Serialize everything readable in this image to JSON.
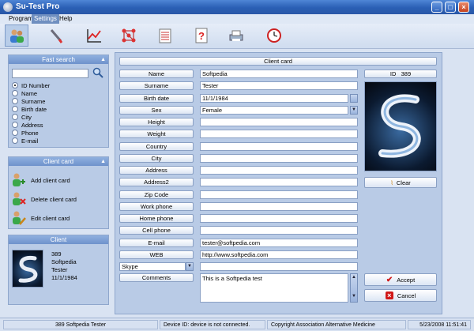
{
  "window": {
    "title": "Su-Test Pro",
    "minimize": "_",
    "maximize": "□",
    "close": "×"
  },
  "menu": [
    "Program",
    "Settings",
    "Help"
  ],
  "toolbar": {
    "icons": [
      "clients-icon",
      "pipette-icon",
      "chart-icon",
      "molecule-icon",
      "notepad-icon",
      "question-icon",
      "printer-icon",
      "clock-icon"
    ]
  },
  "fast_search": {
    "title": "Fast search",
    "query": "",
    "options": [
      "ID Number",
      "Name",
      "Surname",
      "Birth date",
      "City",
      "Address",
      "Phone",
      "E-mail"
    ],
    "selected": "ID Number"
  },
  "client_card_panel": {
    "title": "Client card",
    "actions": [
      "Add client card",
      "Delete client card",
      "Edit client card"
    ]
  },
  "client_panel": {
    "title": "Client",
    "lines": [
      "389",
      "Softpedia",
      "Tester",
      "11/1/1984"
    ]
  },
  "form": {
    "title": "Client card",
    "fields": [
      {
        "label": "Name",
        "value": "Softpedia"
      },
      {
        "label": "Surname",
        "value": "Tester"
      },
      {
        "label": "Birth date",
        "value": "11/1/1984"
      },
      {
        "label": "Sex",
        "value": "Female"
      },
      {
        "label": "Height",
        "value": ""
      },
      {
        "label": "Weight",
        "value": ""
      },
      {
        "label": "Country",
        "value": ""
      },
      {
        "label": "City",
        "value": ""
      },
      {
        "label": "Address",
        "value": ""
      },
      {
        "label": "Address2",
        "value": ""
      },
      {
        "label": "Zip Code",
        "value": ""
      },
      {
        "label": "Work phone",
        "value": ""
      },
      {
        "label": "Home phone",
        "value": ""
      },
      {
        "label": "Cell phone",
        "value": ""
      },
      {
        "label": "E-mail",
        "value": "tester@softpedia.com"
      },
      {
        "label": "WEB",
        "value": "http://www.softpedia.com"
      },
      {
        "label": "Skype",
        "value": ""
      }
    ],
    "comments_label": "Comments",
    "comments_value": "This is a Softpedia test",
    "id_label": "ID",
    "id_value": "389",
    "clear_label": "Clear",
    "accept_label": "Accept",
    "cancel_label": "Cancel"
  },
  "status": {
    "client": "389   Softpedia   Tester",
    "device": "Device ID: device is not connected.",
    "copyright": "Copyright     Association Alternative Medicine",
    "datetime": "5/23/2008 11:51:41"
  },
  "colors": {
    "accent": "#2a5fb4",
    "panel": "#b9cbe6",
    "background": "#d9e3f2"
  }
}
